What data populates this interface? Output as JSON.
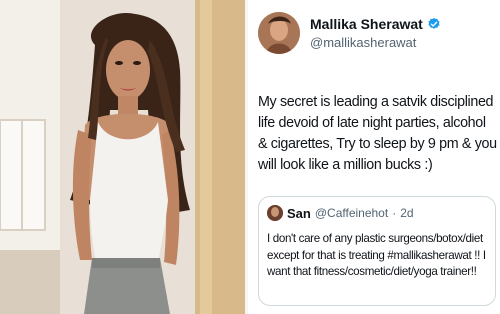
{
  "tweet": {
    "display_name": "Mallika Sherawat",
    "verified_icon": "verified-badge-icon",
    "handle": "@mallikasherawat",
    "text": "My secret is leading a satvik disciplined life devoid of late night parties, alcohol & cigarettes, Try to sleep by 9 pm & you will look like a million bucks :)"
  },
  "quote": {
    "author": "San",
    "handle": "@Caffeinehot",
    "separator": "·",
    "time": "2d",
    "text": "I don't care of any plastic surgeons/botox/diet except for that is treating #mallikasherawat !! I want that fitness/cosmetic/diet/yoga trainer!!"
  },
  "colors": {
    "verified": "#1d9bf0",
    "text": "#0f1419",
    "secondary": "#536471",
    "border": "#cfd9de"
  }
}
